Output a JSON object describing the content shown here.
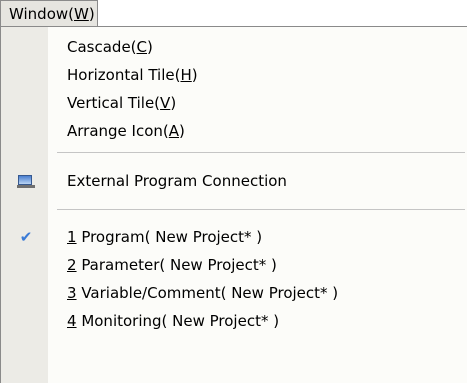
{
  "menubar": {
    "title_pre": "Window(",
    "title_key": "W",
    "title_post": ")"
  },
  "menu": {
    "cascade": {
      "pre": "Cascade(",
      "key": "C",
      "post": ")"
    },
    "horizontal": {
      "pre": "Horizontal Tile(",
      "key": "H",
      "post": ")"
    },
    "vertical": {
      "pre": "Vertical Tile(",
      "key": "V",
      "post": ")"
    },
    "arrange": {
      "pre": "Arrange Icon(",
      "key": "A",
      "post": ")"
    },
    "external": {
      "label": "External Program Connection",
      "icon": "monitor-icon"
    },
    "windows": [
      {
        "key": "1",
        "rest": " Program( New Project* )",
        "checked": true
      },
      {
        "key": "2",
        "rest": " Parameter( New Project* )",
        "checked": false
      },
      {
        "key": "3",
        "rest": " Variable/Comment( New Project* )",
        "checked": false
      },
      {
        "key": "4",
        "rest": " Monitoring( New Project* )",
        "checked": false
      }
    ]
  },
  "colors": {
    "check": "#3b7bd6",
    "menu_bg": "#fcfcf9",
    "icon_column": "#ecebe6"
  }
}
